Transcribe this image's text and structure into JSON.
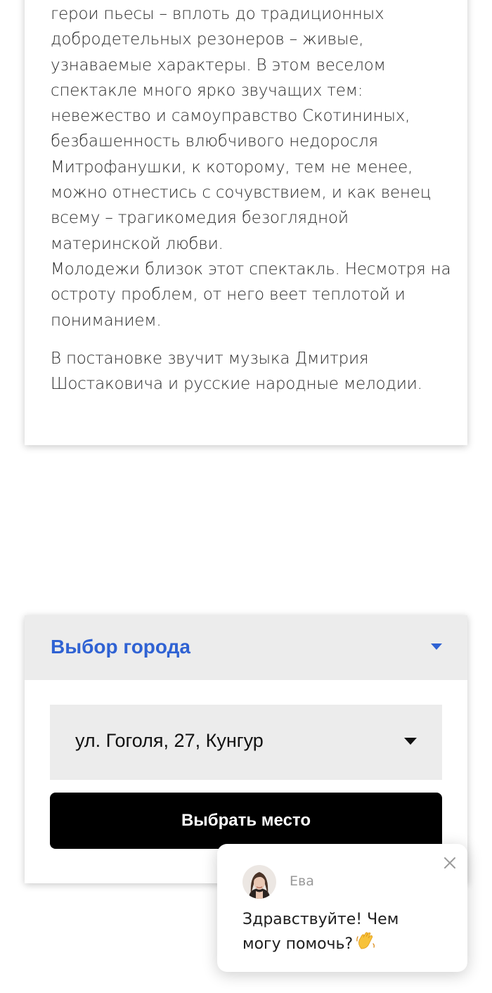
{
  "description": {
    "lines": [
      "герои пьесы – вплоть до традиционных",
      "добродетельных резонеров – живые,",
      "узнаваемые характеры. В этом веселом",
      "спектакле много ярко звучащих тем:",
      "невежество и самоуправство Скотининых,",
      "безбашенность влюбчивого недоросля",
      "Митрофанушки, к которому, тем не менее,",
      "можно отнестись с сочувствием, и как венец",
      "всему – трагикомедия безоглядной",
      "материнской любви.",
      "Молодежи близок этот спектакль. Несмотря на",
      "остроту проблем, от него веет теплотой и",
      "пониманием."
    ],
    "music_lines": [
      "В постановке звучит музыка Дмитрия",
      "Шостаковича и русские народные мелодии."
    ]
  },
  "city_selector": {
    "title": "Выбор города",
    "caret_icon": "caret-down-icon",
    "accent_color": "#2f62d3",
    "address_value": "ул. Гоголя, 27, Кунгур",
    "choose_button_label": "Выбрать место"
  },
  "chat": {
    "agent_name": "Ева",
    "message_line1": "Здравствуйте! Чем",
    "message_line2": "могу помочь?",
    "wave_icon": "waving-hand-icon",
    "close_icon": "close-icon"
  }
}
